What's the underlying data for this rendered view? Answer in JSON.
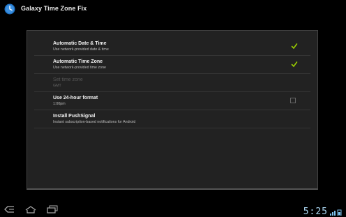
{
  "app": {
    "title": "Galaxy Time Zone Fix",
    "icon": "clock-icon"
  },
  "settings": [
    {
      "title": "Automatic Date & Time",
      "summary": "Use network-provided date & time",
      "control": "check",
      "checked": true,
      "enabled": true
    },
    {
      "title": "Automatic Time Zone",
      "summary": "Use network-provided time zone",
      "control": "check",
      "checked": true,
      "enabled": true
    },
    {
      "title": "Set time zone",
      "summary": "GMT",
      "control": "none",
      "checked": false,
      "enabled": false
    },
    {
      "title": "Use 24-hour format",
      "summary": "1:00pm",
      "control": "checkbox",
      "checked": false,
      "enabled": true
    },
    {
      "title": "Install PushSignal",
      "summary": "Instant subscription-based notifications for Android",
      "control": "none",
      "checked": false,
      "enabled": true
    }
  ],
  "system_bar": {
    "time": "5:25",
    "icons": [
      "back-icon",
      "home-icon",
      "recent-apps-icon",
      "signal-icon"
    ]
  },
  "colors": {
    "accent": "#99cc00",
    "clock": "#a9d5f0",
    "panel": "#222222"
  }
}
